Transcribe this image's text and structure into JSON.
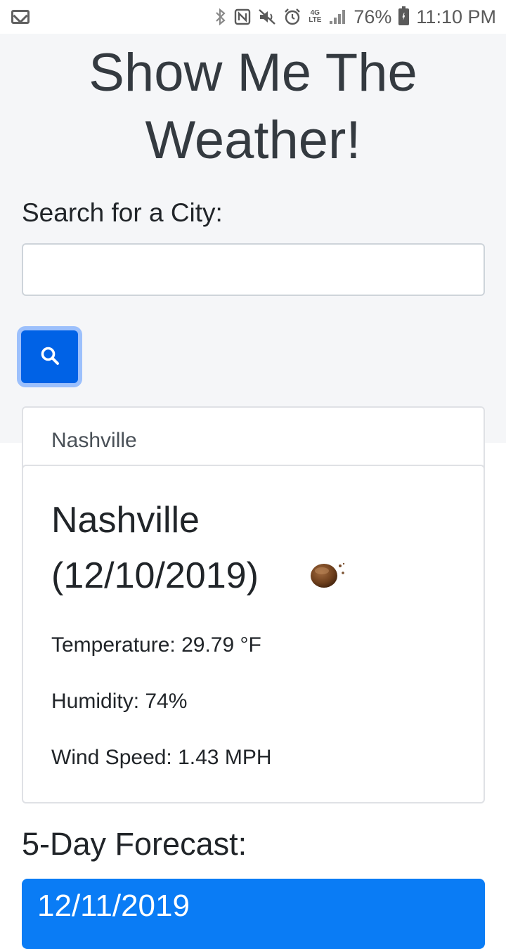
{
  "status_bar": {
    "network_type": "4G LTE",
    "battery_percent": "76%",
    "time": "11:10 PM",
    "icons": [
      "gmail-icon",
      "bluetooth-icon",
      "nfc-icon",
      "mute-icon",
      "alarm-icon",
      "signal-icon",
      "battery-icon"
    ]
  },
  "header": {
    "title": "Show Me The Weather!"
  },
  "search": {
    "label": "Search for a City:",
    "value": "",
    "placeholder": "",
    "button_icon": "search-icon"
  },
  "history": [
    {
      "city": "Nashville"
    }
  ],
  "current": {
    "city": "Nashville",
    "date": "(12/10/2019)",
    "icon": "cloud-night-icon",
    "temperature": "Temperature: 29.79 °F",
    "humidity": "Humidity: 74%",
    "wind_speed": "Wind Speed: 1.43 MPH"
  },
  "forecast": {
    "title": "5-Day Forecast:",
    "days": [
      {
        "date": "12/11/2019"
      }
    ]
  },
  "colors": {
    "primary": "#0062e6",
    "forecast_card": "#0a7cf5",
    "hero_background": "#f5f6f8"
  }
}
